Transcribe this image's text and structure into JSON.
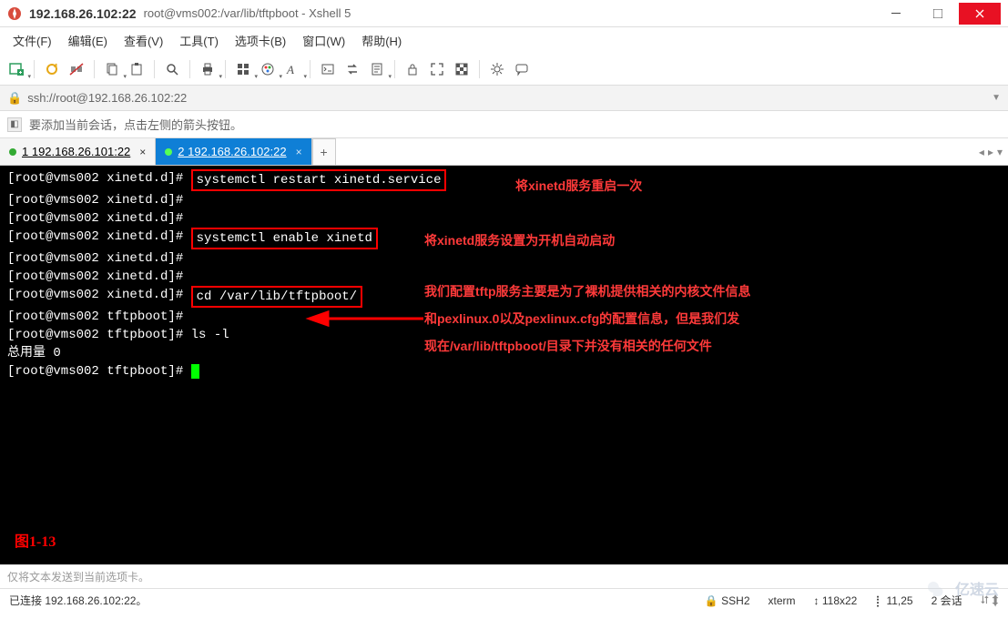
{
  "window": {
    "title_ip": "192.168.26.102:22",
    "title_path": "root@vms002:/var/lib/tftpboot - Xshell 5"
  },
  "menu": {
    "file": "文件(F)",
    "edit": "编辑(E)",
    "view": "查看(V)",
    "tools": "工具(T)",
    "tabs": "选项卡(B)",
    "window": "窗口(W)",
    "help": "帮助(H)"
  },
  "url": {
    "text": "ssh://root@192.168.26.102:22"
  },
  "hint": {
    "text": "要添加当前会话，点击左侧的箭头按钮。"
  },
  "tabs_strip": {
    "tab1": "1 192.168.26.101:22",
    "tab2": "2 192.168.26.102:22"
  },
  "terminal": {
    "p1": "[root@vms002 xinetd.d]#",
    "cmd1": "systemctl restart xinetd.service",
    "p2": "[root@vms002 xinetd.d]#",
    "p3": "[root@vms002 xinetd.d]#",
    "p4": "[root@vms002 xinetd.d]#",
    "cmd2": "systemctl enable xinetd",
    "p5": "[root@vms002 xinetd.d]#",
    "p6": "[root@vms002 xinetd.d]#",
    "p7": "[root@vms002 xinetd.d]#",
    "cmd3": "cd /var/lib/tftpboot/",
    "p8": "[root@vms002 tftpboot]#",
    "p9": "[root@vms002 tftpboot]#",
    "cmd4": "ls -l",
    "total": "总用量 0",
    "p10": "[root@vms002 tftpboot]#"
  },
  "annotations": {
    "a1": "将xinetd服务重启一次",
    "a2": "将xinetd服务设置为开机自动启动",
    "a3l1": "我们配置tftp服务主要是为了裸机提供相关的内核文件信息",
    "a3l2": "和pexlinux.0以及pexlinux.cfg的配置信息，但是我们发",
    "a3l3": "现在/var/lib/tftpboot/目录下并没有相关的任何文件",
    "fig": "图1-13"
  },
  "input_hint": "仅将文本发送到当前选项卡。",
  "status": {
    "conn": "已连接 192.168.26.102:22。",
    "ssh": "SSH2",
    "term": "xterm",
    "size": "118x22",
    "pos": "11,25",
    "sess": "2 会话"
  },
  "watermark": "亿速云"
}
